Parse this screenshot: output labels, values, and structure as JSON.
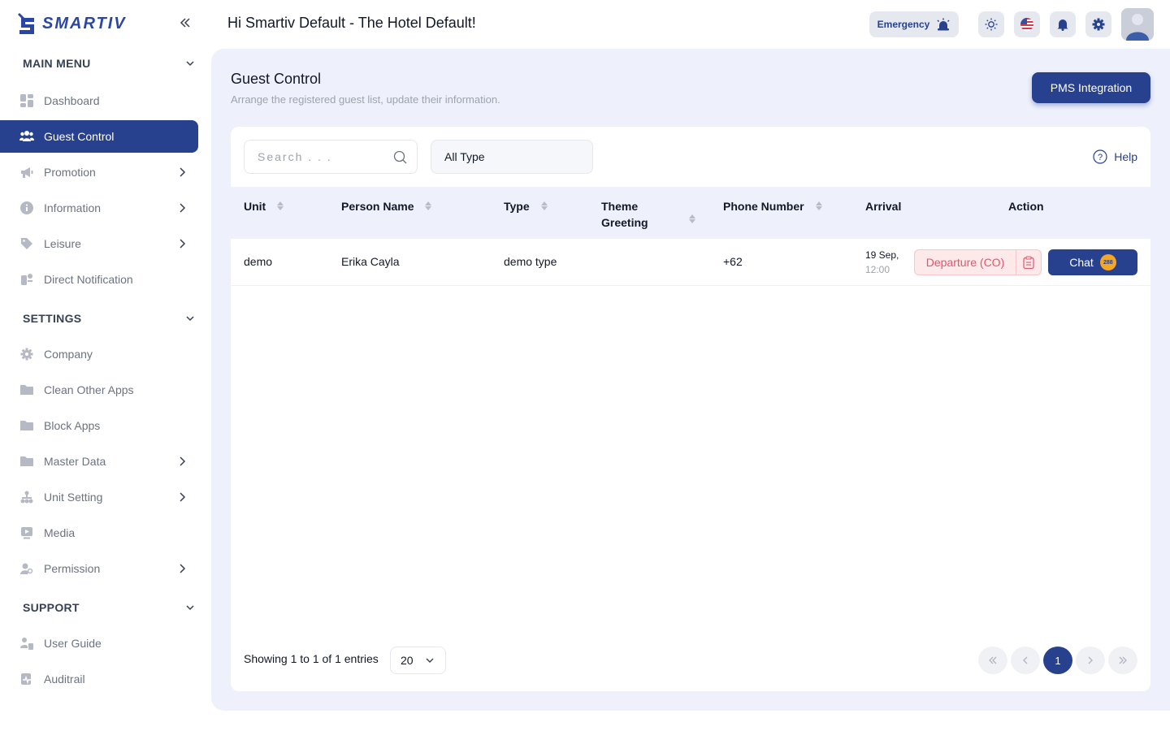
{
  "brand": {
    "name": "SMARTIV"
  },
  "sidebar": {
    "main_menu_label": "MAIN MENU",
    "settings_label": "SETTINGS",
    "support_label": "SUPPORT",
    "main_items": [
      {
        "label": "Dashboard",
        "icon": "dashboard-icon"
      },
      {
        "label": "Guest Control",
        "icon": "users-icon",
        "active": true
      },
      {
        "label": "Promotion",
        "icon": "megaphone-icon"
      },
      {
        "label": "Information",
        "icon": "info-icon"
      },
      {
        "label": "Leisure",
        "icon": "tag-icon"
      },
      {
        "label": "Direct Notification",
        "icon": "notification-icon"
      }
    ],
    "settings_items": [
      {
        "label": "Company",
        "icon": "gear-icon"
      },
      {
        "label": "Clean Other Apps",
        "icon": "folder-icon"
      },
      {
        "label": "Block Apps",
        "icon": "folder-icon"
      },
      {
        "label": "Master Data",
        "icon": "folder-icon"
      },
      {
        "label": "Unit Setting",
        "icon": "sitemap-icon"
      },
      {
        "label": "Media",
        "icon": "media-icon"
      },
      {
        "label": "Permission",
        "icon": "user-key-icon"
      }
    ],
    "support_items": [
      {
        "label": "User Guide",
        "icon": "user-guide-icon"
      },
      {
        "label": "Auditrail",
        "icon": "audit-icon"
      }
    ]
  },
  "header": {
    "greeting": "Hi Smartiv Default - The Hotel Default!",
    "emergency_label": "Emergency"
  },
  "page": {
    "title": "Guest Control",
    "subtitle": "Arrange the registered guest list, update their information.",
    "pms_button": "PMS Integration"
  },
  "filters": {
    "search_placeholder": "Search . . .",
    "type_selected": "All Type",
    "help_label": "Help"
  },
  "table": {
    "columns": [
      "Unit",
      "Person Name",
      "Type",
      "Theme Greeting",
      "Phone Number",
      "Arrival",
      "Action"
    ],
    "theme_col_line1": "Theme",
    "theme_col_line2": "Greeting",
    "rows": [
      {
        "unit": "demo",
        "person_name": "Erika Cayla",
        "type": "demo type",
        "theme_greeting": "",
        "phone": "+62",
        "arrival_date": "19 Sep,",
        "arrival_time": "12:00",
        "departure_label": "Departure (CO)",
        "chat_label": "Chat",
        "chat_badge": "288"
      }
    ]
  },
  "footer": {
    "entries_text": "Showing 1 to 1 of 1 entries",
    "page_size": "20",
    "current_page": "1"
  },
  "colors": {
    "primary": "#27418e",
    "panel_bg": "#eef0fb",
    "danger": "#e0566a",
    "badge": "#f5a623"
  }
}
